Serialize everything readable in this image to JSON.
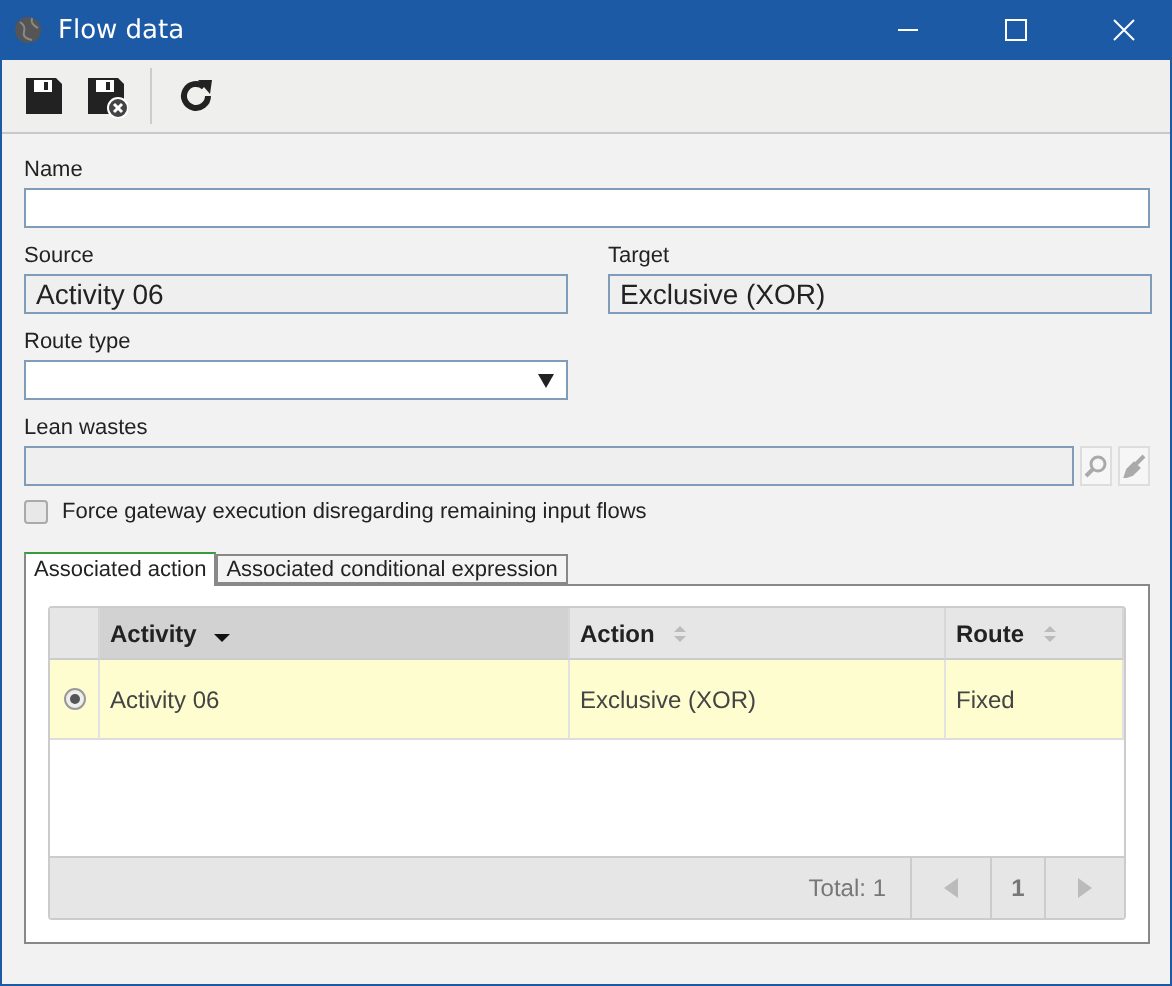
{
  "window": {
    "title": "Flow data"
  },
  "toolbar": [
    {
      "kind": "save"
    },
    {
      "kind": "save-close"
    },
    {
      "kind": "separator"
    },
    {
      "kind": "refresh"
    }
  ],
  "fields": {
    "name": {
      "label": "Name"
    },
    "source": {
      "label": "Source",
      "value": "Activity 06"
    },
    "target": {
      "label": "Target",
      "value": "Exclusive (XOR)"
    },
    "route_type": {
      "label": "Route type"
    },
    "lean_wastes": {
      "label": "Lean wastes"
    }
  },
  "force_gateway": {
    "label": "Force gateway execution disregarding remaining input flows",
    "checked": false
  },
  "tabs": [
    {
      "label": "Associated action",
      "selected": true
    },
    {
      "label": "Associated conditional expression",
      "selected": false
    }
  ],
  "grid": {
    "columns": [
      {
        "label": "Activity",
        "sorted": true
      },
      {
        "label": "Action",
        "sorted": false
      },
      {
        "label": "Route",
        "sorted": false
      }
    ],
    "rows": [
      {
        "selected": true,
        "cells": [
          "Activity 06",
          "Exclusive (XOR)",
          "Fixed"
        ]
      }
    ],
    "total": "Total: 1",
    "page": "1"
  }
}
